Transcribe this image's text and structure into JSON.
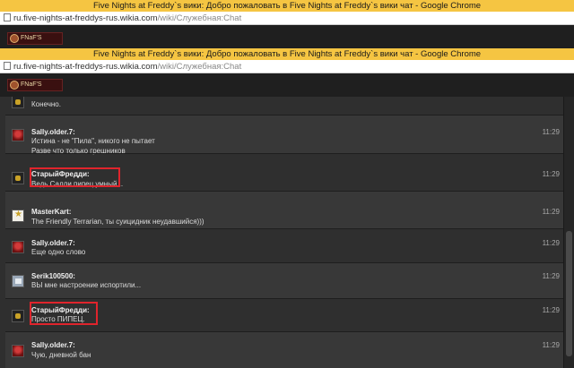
{
  "window_back": {
    "title": "Five Nights at Freddy`s вики: Добро пожаловать в Five Nights at Freddy`s вики чат - Google Chrome",
    "url_host": "ru.five-nights-at-freddys-rus.wikia.com",
    "url_path": "/wiki/Служебная:Chat"
  },
  "window_front": {
    "title": "Five Nights at Freddy`s вики: Добро пожаловать в Five Nights at Freddy`s вики чат - Google Chrome",
    "url_host": "ru.five-nights-at-freddys-rus.wikia.com",
    "url_path": "/wiki/Служебная:Chat"
  },
  "logo_text": "FNaF'S",
  "messages": [
    {
      "user": "",
      "lines": [
        "Конечно."
      ],
      "time": "",
      "avatar": "freddy-avatar"
    },
    {
      "user": "Sally.older.7:",
      "lines": [
        "Истина - не \"Пила\", никого не пытает",
        "Разве что только грешников"
      ],
      "time": "11:29",
      "avatar": "sally-avatar"
    },
    {
      "user": "СтарыйФредди:",
      "lines": [
        "Ведь Салли пипец умный..."
      ],
      "time": "11:29",
      "avatar": "freddy-avatar"
    },
    {
      "user": "MasterKart:",
      "lines": [
        "The Friendly Terrarian, ты суицидник неудавшийся)))"
      ],
      "time": "11:29",
      "avatar": "master-avatar"
    },
    {
      "user": "Sally.older.7:",
      "lines": [
        "Еще одно слово"
      ],
      "time": "11:29",
      "avatar": "sally-avatar"
    },
    {
      "user": "Serik100500:",
      "lines": [
        "ВЫ мне настроение испортили..."
      ],
      "time": "11:29",
      "avatar": "serik-avatar"
    },
    {
      "user": "СтарыйФредди:",
      "lines": [
        "Просто ПИПЕЦ."
      ],
      "time": "11:29",
      "avatar": "freddy-avatar"
    },
    {
      "user": "Sally.older.7:",
      "lines": [
        "Чую, дневной бан"
      ],
      "time": "11:29",
      "avatar": "sally-avatar"
    }
  ],
  "colors": {
    "title_bar": "#f5c542",
    "chat_bg": "#2f2f2f",
    "highlight_box": "#e0242c"
  }
}
